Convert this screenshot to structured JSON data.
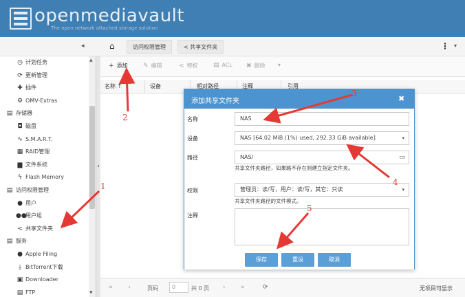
{
  "header": {
    "title": "openmediavault",
    "subtitle": "The open network attached storage solution"
  },
  "topbar": {
    "collapse_glyph": "◂",
    "breadcrumbs": [
      "访问权限管理",
      "共享文件夹"
    ],
    "menu_glyph": "⋮",
    "menu_chevron": "▾"
  },
  "sidebar": {
    "items": [
      {
        "label": "计划任务",
        "icon": "clock-icon",
        "glyph": "◷",
        "group": false
      },
      {
        "label": "更新管理",
        "icon": "refresh-icon",
        "glyph": "⟳",
        "group": false
      },
      {
        "label": "插件",
        "icon": "plugin-icon",
        "glyph": "✚",
        "group": false
      },
      {
        "label": "OMV-Extras",
        "icon": "gear-icon",
        "glyph": "⚙",
        "group": false
      },
      {
        "label": "存储器",
        "icon": "storage-icon",
        "glyph": "▤",
        "group": true
      },
      {
        "label": "磁盘",
        "icon": "disk-icon",
        "glyph": "◘",
        "group": false
      },
      {
        "label": "S.M.A.R.T.",
        "icon": "pulse-icon",
        "glyph": "∿",
        "group": false
      },
      {
        "label": "RAID管理",
        "icon": "raid-icon",
        "glyph": "▦",
        "group": false
      },
      {
        "label": "文件系统",
        "icon": "folder-icon",
        "glyph": "▆",
        "group": false
      },
      {
        "label": "Flash Memory",
        "icon": "flash-icon",
        "glyph": "ϟ",
        "group": false
      },
      {
        "label": "访问权限管理",
        "icon": "access-icon",
        "glyph": "▤",
        "group": true
      },
      {
        "label": "用户",
        "icon": "user-icon",
        "glyph": "●",
        "group": false
      },
      {
        "label": "用户组",
        "icon": "users-icon",
        "glyph": "●●",
        "group": false
      },
      {
        "label": "共享文件夹",
        "icon": "share-icon",
        "glyph": "<",
        "group": false
      },
      {
        "label": "服务",
        "icon": "services-icon",
        "glyph": "▤",
        "group": true
      },
      {
        "label": "Apple Filing",
        "icon": "apple-icon",
        "glyph": "●",
        "group": false
      },
      {
        "label": "BitTorrent下载",
        "icon": "download-icon",
        "glyph": "⤓",
        "group": false
      },
      {
        "label": "Downloader",
        "icon": "downloader-icon",
        "glyph": "▣",
        "group": false
      },
      {
        "label": "FTP",
        "icon": "ftp-icon",
        "glyph": "▤",
        "group": false
      }
    ]
  },
  "grid": {
    "toolbar": {
      "add": {
        "glyph": "+",
        "label": "添加"
      },
      "edit": {
        "glyph": "✎",
        "label": "编辑"
      },
      "privileges": {
        "glyph": "<",
        "label": "特权"
      },
      "acl": {
        "glyph": "▤",
        "label": "ACL"
      },
      "delete": {
        "glyph": "✖",
        "label": "删除"
      },
      "more": "▾"
    },
    "columns": [
      "名称",
      "设备",
      "相对路径",
      "注释",
      "引用"
    ],
    "sort_glyph": "↑",
    "pager": {
      "first": "«",
      "prev": "‹",
      "page_label": "页码",
      "page_value": "0",
      "of_pages": "共 0 页",
      "next": "›",
      "last": "»",
      "refresh": "⟳",
      "empty_text": "无项目可显示"
    }
  },
  "modal": {
    "title": "添加共享文件夹",
    "close": "✖",
    "fields": {
      "name": {
        "label": "名称",
        "value": "NAS"
      },
      "device": {
        "label": "设备",
        "value": "NAS [64.02 MiB (1%) used, 292.33 GiB available]",
        "caret": "▾"
      },
      "path": {
        "label": "路径",
        "value": "NAS/",
        "hint": "共享文件夹路径，如果路不存在则建立指定文件夹。",
        "glyph": "▭"
      },
      "permissions": {
        "label": "权限",
        "value": "管理员：读/写，用户：读/写，其它：只读",
        "hint": "共享文件夹路径的文件模式。",
        "caret": "▾"
      },
      "comment": {
        "label": "注释",
        "value": ""
      }
    },
    "buttons": {
      "save": "保存",
      "reset": "重设",
      "cancel": "取消"
    }
  },
  "annotations": [
    "1",
    "2",
    "3",
    "4",
    "5"
  ],
  "colors": {
    "header": "#3f7fb4",
    "accent": "#4d93cf",
    "annotation": "#e53935"
  }
}
